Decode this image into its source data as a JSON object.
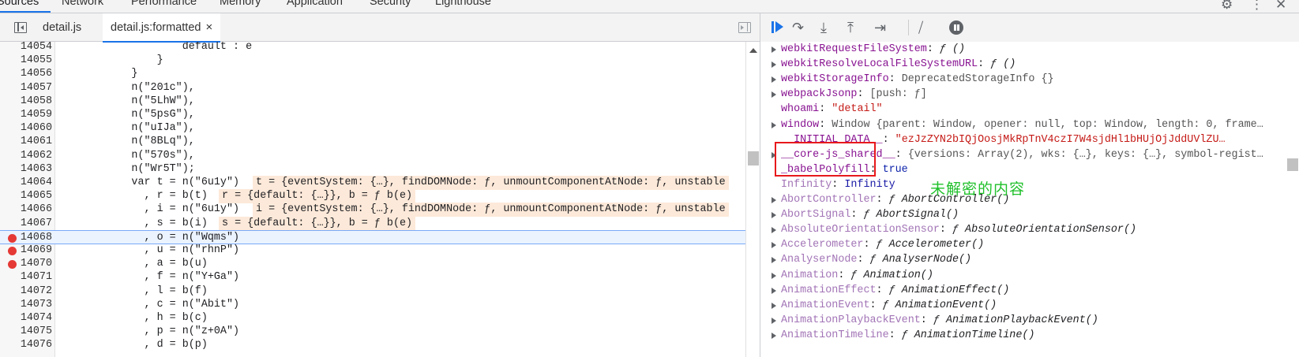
{
  "devtools_tabs": [
    {
      "label": "Sources",
      "active": true
    },
    {
      "label": "Network"
    },
    {
      "label": "Performance"
    },
    {
      "label": "Memory"
    },
    {
      "label": "Application"
    },
    {
      "label": "Security"
    },
    {
      "label": "Lighthouse"
    }
  ],
  "top_right_icons": [
    "gear-icon",
    "more-vertical-icon",
    "close-icon"
  ],
  "file_tabs": [
    {
      "label": "detail.js",
      "active": false
    },
    {
      "label": "detail.js:formatted",
      "active": true,
      "close": "×"
    }
  ],
  "code_lines": [
    {
      "n": "14054",
      "text": "                    default : e"
    },
    {
      "n": "14055",
      "text": "                }"
    },
    {
      "n": "14056",
      "text": "            }"
    },
    {
      "n": "14057",
      "text": "            n(\"201c\"),"
    },
    {
      "n": "14058",
      "text": "            n(\"5LhW\"),"
    },
    {
      "n": "14059",
      "text": "            n(\"5psG\"),"
    },
    {
      "n": "14060",
      "text": "            n(\"uIJa\"),"
    },
    {
      "n": "14061",
      "text": "            n(\"8BLq\"),"
    },
    {
      "n": "14062",
      "text": "            n(\"570s\"),"
    },
    {
      "n": "14063",
      "text": "            n(\"Wr5T\");"
    },
    {
      "n": "14064",
      "text": "            var t = n(\"6u1y\")",
      "inline": "t = {eventSystem: {…}, findDOMNode: ƒ, unmountComponentAtNode: ƒ, unstable"
    },
    {
      "n": "14065",
      "text": "              , r = b(t)",
      "inline": "r = {default: {…}}, b = ƒ b(e)"
    },
    {
      "n": "14066",
      "text": "              , i = n(\"6u1y\")",
      "inline": "i = {eventSystem: {…}, findDOMNode: ƒ, unmountComponentAtNode: ƒ, unstable"
    },
    {
      "n": "14067",
      "text": "              , s = b(i)",
      "inline": "s = {default: {…}}, b = ƒ b(e)"
    },
    {
      "n": "14068",
      "text": "              , o = n(\"Wqms\")",
      "breakpoint": true,
      "exec": true
    },
    {
      "n": "14069",
      "text": "              , u = n(\"rhnP\")",
      "breakpoint": true
    },
    {
      "n": "14070",
      "text": "              , a = b(u)",
      "breakpoint": true
    },
    {
      "n": "14071",
      "text": "              , f = n(\"Y+Ga\")"
    },
    {
      "n": "14072",
      "text": "              , l = b(f)"
    },
    {
      "n": "14073",
      "text": "              , c = n(\"Abit\")"
    },
    {
      "n": "14074",
      "text": "              , h = b(c)"
    },
    {
      "n": "14075",
      "text": "              , p = n(\"z+0A\")"
    },
    {
      "n": "14076",
      "text": "              , d = b(p)"
    }
  ],
  "debugger_toolbar": [
    "resume-icon",
    "step-over-icon",
    "step-into-icon",
    "step-out-icon",
    "step-icon",
    "deactivate-breakpoints-icon",
    "pause-on-exceptions-icon"
  ],
  "scope_props": [
    {
      "name": "webkitRequestFileSystem",
      "value": "ƒ ()",
      "expandable": true,
      "kind": "fn"
    },
    {
      "name": "webkitResolveLocalFileSystemURL",
      "value": "ƒ ()",
      "expandable": true,
      "kind": "fn"
    },
    {
      "name": "webkitStorageInfo",
      "value": "DeprecatedStorageInfo {}",
      "expandable": true,
      "kind": "obj"
    },
    {
      "name": "webpackJsonp",
      "value": "[push: ƒ]",
      "expandable": true,
      "kind": "obj"
    },
    {
      "name": "whoami",
      "value": "\"detail\"",
      "expandable": false,
      "kind": "str"
    },
    {
      "name": "window",
      "value": "Window {parent: Window, opener: null, top: Window, length: 0, frame…",
      "expandable": true,
      "kind": "obj"
    },
    {
      "name": "__INITIAL_DATA__",
      "value": "\"ezJzZYN2bIQjOosjMkRpTnV4czI7W4sjdHl1bHUjOjJddUVlZU…",
      "expandable": false,
      "kind": "str"
    },
    {
      "name": "__core-js_shared__",
      "value": "{versions: Array(2), wks: {…}, keys: {…}, symbol-regist…",
      "expandable": true,
      "kind": "obj"
    },
    {
      "name": "_babelPolyfill",
      "value": "true",
      "expandable": false,
      "kind": "kw"
    },
    {
      "name": "Infinity",
      "value": "Infinity",
      "expandable": false,
      "kind": "num",
      "dim": true
    },
    {
      "name": "AbortController",
      "value": "ƒ AbortController()",
      "expandable": true,
      "kind": "fn",
      "dim": true
    },
    {
      "name": "AbortSignal",
      "value": "ƒ AbortSignal()",
      "expandable": true,
      "kind": "fn",
      "dim": true
    },
    {
      "name": "AbsoluteOrientationSensor",
      "value": "ƒ AbsoluteOrientationSensor()",
      "expandable": true,
      "kind": "fn",
      "dim": true
    },
    {
      "name": "Accelerometer",
      "value": "ƒ Accelerometer()",
      "expandable": true,
      "kind": "fn",
      "dim": true
    },
    {
      "name": "AnalyserNode",
      "value": "ƒ AnalyserNode()",
      "expandable": true,
      "kind": "fn",
      "dim": true
    },
    {
      "name": "Animation",
      "value": "ƒ Animation()",
      "expandable": true,
      "kind": "fn",
      "dim": true
    },
    {
      "name": "AnimationEffect",
      "value": "ƒ AnimationEffect()",
      "expandable": true,
      "kind": "fn",
      "dim": true
    },
    {
      "name": "AnimationEvent",
      "value": "ƒ AnimationEvent()",
      "expandable": true,
      "kind": "fn",
      "dim": true
    },
    {
      "name": "AnimationPlaybackEvent",
      "value": "ƒ AnimationPlaybackEvent()",
      "expandable": true,
      "kind": "fn",
      "dim": true
    },
    {
      "name": "AnimationTimeline",
      "value": "ƒ AnimationTimeline()",
      "expandable": true,
      "kind": "fn",
      "dim": true
    }
  ],
  "annotation": {
    "text": "未解密的内容",
    "color": "#1fc02a",
    "box_color": "#e8191c"
  },
  "colors": {
    "accent": "#1a73e8",
    "breakpoint": "#e53935",
    "string": "#c41a16",
    "property": "#881391"
  }
}
